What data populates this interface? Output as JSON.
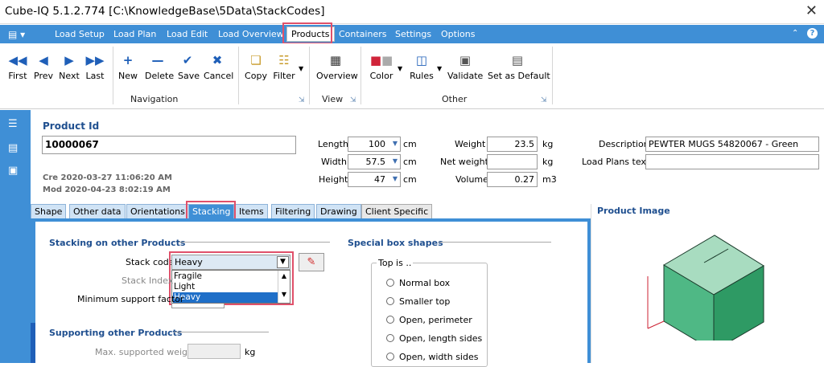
{
  "window": {
    "title": "Cube-IQ  5.1.2.774  [C:\\KnowledgeBase\\5Data\\StackCodes]",
    "close": "✕"
  },
  "menu": {
    "items": [
      "Load Setup",
      "Load Plan",
      "Load Edit",
      "Load Overview",
      "Products",
      "Containers",
      "Settings",
      "Options"
    ],
    "active": "Products",
    "up_icon": "⌃",
    "help_icon": "?"
  },
  "ribbon": {
    "buttons": {
      "first": "First",
      "prev": "Prev",
      "next": "Next",
      "last": "Last",
      "new": "New",
      "delete": "Delete",
      "save": "Save",
      "cancel": "Cancel",
      "copy": "Copy",
      "filter": "Filter",
      "overview": "Overview",
      "color": "Color",
      "rules": "Rules",
      "validate": "Validate",
      "set_default": "Set as Default"
    },
    "groups": {
      "navigation": "Navigation",
      "view": "View",
      "other": "Other"
    }
  },
  "product": {
    "id_label": "Product Id",
    "id_value": "10000067",
    "created": "Cre 2020-03-27 11:06:20 AM",
    "modified": "Mod 2020-04-23 8:02:19 AM",
    "length_label": "Length",
    "length_value": "100",
    "width_label": "Width",
    "width_value": "57.5",
    "height_label": "Height",
    "height_value": "47",
    "dim_unit": "cm",
    "weight_label": "Weight",
    "weight_value": "23.5",
    "weight_unit": "kg",
    "net_weight_label": "Net weight",
    "net_weight_value": "",
    "net_weight_unit": "kg",
    "volume_label": "Volume",
    "volume_value": "0.27",
    "volume_unit": "m3",
    "description_label": "Description",
    "description_value": "PEWTER MUGS 54820067 - Green",
    "load_plans_label": "Load Plans text",
    "load_plans_value": ""
  },
  "tabs": [
    "Shape",
    "Other data",
    "Orientations",
    "Stacking",
    "Items",
    "Filtering",
    "Drawing",
    "Client Specific"
  ],
  "active_tab": "Stacking",
  "stacking": {
    "section_title": "Stacking on other Products",
    "stack_code_label": "Stack code",
    "stack_code_value": "Heavy",
    "options": [
      "Fragile",
      "Light",
      "Heavy"
    ],
    "selected_option": "Heavy",
    "stack_index_label": "Stack Index",
    "min_support_label": "Minimum support factor",
    "supporting_title": "Supporting other Products",
    "max_weight_label": "Max. supported weight",
    "max_weight_value": "",
    "max_weight_unit": "kg"
  },
  "special": {
    "title": "Special box shapes",
    "group_label": "Top is ..",
    "options": [
      "Normal box",
      "Smaller top",
      "Open, perimeter",
      "Open, length sides",
      "Open, width sides"
    ]
  },
  "image_panel": {
    "title": "Product Image"
  },
  "colors": {
    "accent": "#3f8fd6",
    "highlight": "#e0506a",
    "box_top": "#a8dcc0",
    "box_front": "#4fb885",
    "box_side": "#2e9a64"
  }
}
